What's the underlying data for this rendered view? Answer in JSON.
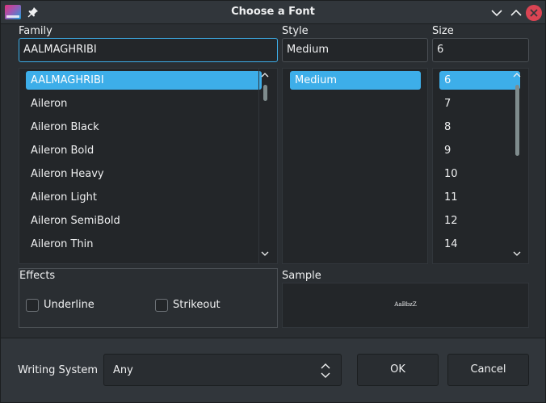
{
  "window": {
    "title": "Choose a Font"
  },
  "icons": {
    "app": "font-app-icon",
    "pin": "pin-icon",
    "minimize": "chevron-down-icon",
    "maximize": "chevron-up-icon",
    "close": "close-icon"
  },
  "family": {
    "label": "Family",
    "value": "AALMAGHRIBI",
    "items": [
      "AALMAGHRIBI",
      "Aileron",
      "Aileron Black",
      "Aileron Bold",
      "Aileron Heavy",
      "Aileron Light",
      "Aileron SemiBold",
      "Aileron Thin"
    ],
    "selected_index": 0
  },
  "style": {
    "label": "Style",
    "value": "Medium",
    "items": [
      "Medium"
    ],
    "selected_index": 0
  },
  "size": {
    "label": "Size",
    "value": "6",
    "items": [
      "6",
      "7",
      "8",
      "9",
      "10",
      "11",
      "12",
      "14"
    ],
    "selected_index": 0
  },
  "effects": {
    "label": "Effects",
    "underline_label": "Underline",
    "underline_checked": false,
    "strikeout_label": "Strikeout",
    "strikeout_checked": false
  },
  "sample": {
    "label": "Sample",
    "text": "AaBbzZ"
  },
  "writing_system": {
    "label": "Writing System",
    "value": "Any"
  },
  "buttons": {
    "ok": "OK",
    "cancel": "Cancel"
  },
  "colors": {
    "accent": "#3daee9",
    "close": "#da4453",
    "background": "#2a2e32",
    "field": "#232629"
  }
}
